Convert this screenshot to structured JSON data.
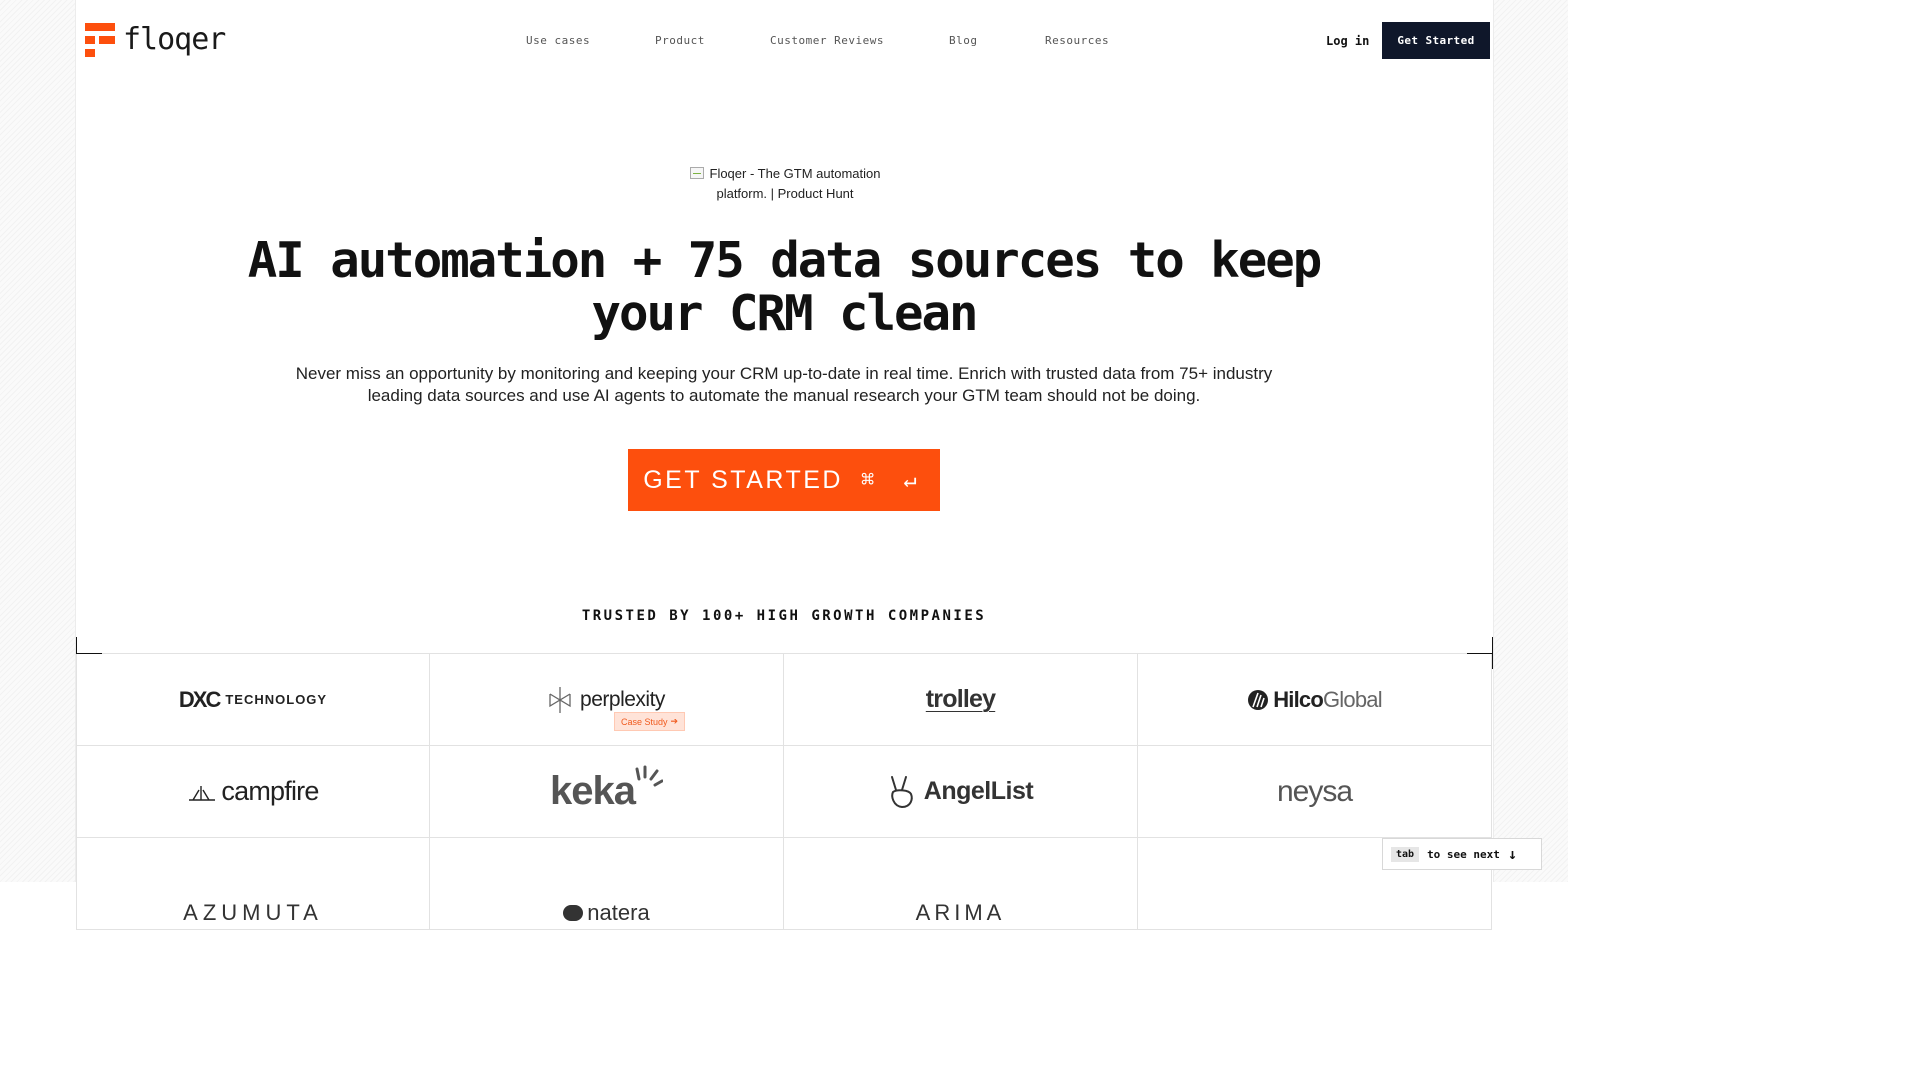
{
  "brand": {
    "name": "floqer",
    "accent": "#fd4f0d",
    "dark": "#0f172a"
  },
  "nav": {
    "items": [
      "Use cases",
      "Product",
      "Customer Reviews",
      "Blog",
      "Resources"
    ],
    "login": "Log in",
    "cta": "Get Started"
  },
  "hero": {
    "badge_alt": "Floqer - The GTM automation platform. | Product Hunt",
    "title": "AI automation + 75 data sources to keep your CRM clean",
    "subtitle": "Never miss an opportunity by monitoring and keeping your CRM up-to-date in real time. Enrich with trusted data from 75+ industry leading data sources and use AI agents to automate the manual research your GTM team should not be doing.",
    "cta_label": "GET STARTED",
    "cta_keys": "⌘ ↵"
  },
  "trusted": {
    "heading": "TRUSTED BY 100+ HIGH GROWTH COMPANIES",
    "companies": [
      {
        "name": "TECHNOLOGY",
        "mark": "DXC"
      },
      {
        "name": "perplexity",
        "badge": "Case Study"
      },
      {
        "name": "trolley"
      },
      {
        "name_bold": "Hilco",
        "name_light": "Global"
      },
      {
        "name": "campfire"
      },
      {
        "name": "keka"
      },
      {
        "name": "AngelList"
      },
      {
        "name": "neysa"
      },
      {
        "name": "AZUMUTA"
      },
      {
        "name": "natera"
      },
      {
        "name": "ARIMA"
      },
      {
        "name": ""
      }
    ]
  },
  "hint": {
    "key": "tab",
    "text": "to see next"
  },
  "icons": [
    "floqer-logo-icon",
    "broken-image-icon",
    "command-icon",
    "enter-icon",
    "arrow-right-icon",
    "arrow-down-icon"
  ]
}
